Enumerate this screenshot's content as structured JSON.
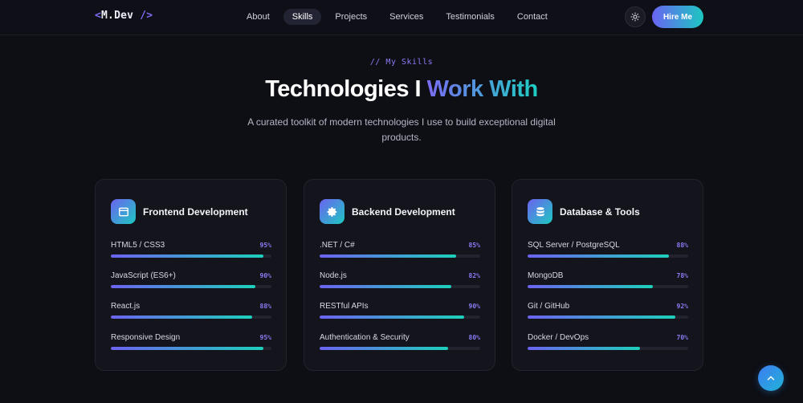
{
  "nav": {
    "logo": {
      "open": "<",
      "name": "M.Dev",
      "close": " />"
    },
    "links": [
      "About",
      "Skills",
      "Projects",
      "Services",
      "Testimonials",
      "Contact"
    ],
    "active_link": "Skills",
    "theme_icon": "sun-icon",
    "hire_label": "Hire Me"
  },
  "section": {
    "eyebrow": "// My Skills",
    "title_plain": "Technologies I ",
    "title_accent": "Work With",
    "subtitle": "A curated toolkit of modern technologies I use to build exceptional digital products."
  },
  "cards": [
    {
      "title": "Frontend Development",
      "icon": "browser-window-icon",
      "skills": [
        {
          "name": "HTML5 / CSS3",
          "pct_label": "95%",
          "level": 95
        },
        {
          "name": "JavaScript (ES6+)",
          "pct_label": "90%",
          "level": 90
        },
        {
          "name": "React.js",
          "pct_label": "88%",
          "level": 88
        },
        {
          "name": "Responsive Design",
          "pct_label": "95%",
          "level": 95
        }
      ]
    },
    {
      "title": "Backend Development",
      "icon": "gear-icon",
      "skills": [
        {
          "name": ".NET / C#",
          "pct_label": "85%",
          "level": 85
        },
        {
          "name": "Node.js",
          "pct_label": "82%",
          "level": 82
        },
        {
          "name": "RESTful APIs",
          "pct_label": "90%",
          "level": 90
        },
        {
          "name": "Authentication & Security",
          "pct_label": "80%",
          "level": 80
        }
      ]
    },
    {
      "title": "Database & Tools",
      "icon": "database-icon",
      "skills": [
        {
          "name": "SQL Server / PostgreSQL",
          "pct_label": "88%",
          "level": 88
        },
        {
          "name": "MongoDB",
          "pct_label": "78%",
          "level": 78
        },
        {
          "name": "Git / GitHub",
          "pct_label": "92%",
          "level": 92
        },
        {
          "name": "Docker / DevOps",
          "pct_label": "70%",
          "level": 70
        }
      ]
    }
  ],
  "scroll_top_icon": "chevron-up-icon",
  "colors": {
    "accent_start": "#6c63f1",
    "accent_end": "#1dd0bc",
    "background": "#0e0f15",
    "card": "#13141c"
  }
}
